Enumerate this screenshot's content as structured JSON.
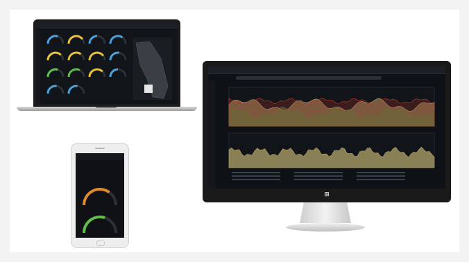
{
  "colors": {
    "background": "#ffffff",
    "dashboard_bg": "#0e1115",
    "accent_blue": "#4aa3df",
    "accent_yellow": "#e8c23a",
    "accent_orange": "#e08a2c",
    "accent_green": "#5fbf4a",
    "series_olive": "#b3a46a",
    "series_green": "#4f7a3b",
    "series_red": "#c0392b"
  },
  "laptop": {
    "title": "",
    "gauges": [
      {
        "color": "#4aa3df",
        "level": 0.6
      },
      {
        "color": "#e8c23a",
        "level": 0.8
      },
      {
        "color": "#4aa3df",
        "level": 0.5
      },
      {
        "color": "#4aa3df",
        "level": 0.7
      },
      {
        "color": "#e8c23a",
        "level": 0.75
      },
      {
        "color": "#e8c23a",
        "level": 0.7
      },
      {
        "color": "#e8c23a",
        "level": 0.8
      },
      {
        "color": "#4aa3df",
        "level": 0.55
      },
      {
        "color": "#5fbf4a",
        "level": 0.6
      },
      {
        "color": "#5fbf4a",
        "level": 0.65
      },
      {
        "color": "#e8c23a",
        "level": 0.75
      },
      {
        "color": "#4aa3df",
        "level": 0.5
      },
      {
        "color": "#4aa3df",
        "level": 0.55
      },
      {
        "color": "#4aa3df",
        "level": 0.55
      }
    ]
  },
  "phone": {
    "title": "",
    "gauges": [
      {
        "color": "#e08a2c",
        "level": 0.7
      },
      {
        "color": "#5fbf4a",
        "level": 0.6
      }
    ]
  },
  "monitor": {
    "tab_label": "",
    "chart_title": "",
    "os_logo_icon": "windows-logo-icon"
  }
}
